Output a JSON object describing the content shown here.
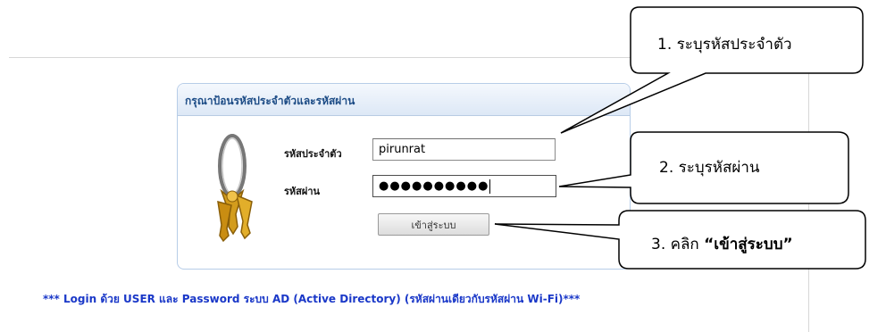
{
  "panel": {
    "title": "กรุณาป้อนรหัสประจำตัวและรหัสผ่าน",
    "user_label": "รหัสประจำตัว",
    "password_label": "รหัสผ่าน",
    "user_value": "pirunrat",
    "password_mask": "●●●●●●●●●●",
    "submit_label": "เข้าสู่ระบบ"
  },
  "footer": {
    "note": "*** Login ด้วย USER และ Password ระบบ AD (Active Directory) (รหัสผ่านเดียวกับรหัสผ่าน Wi-Fi)***"
  },
  "callouts": {
    "step1": "1. ระบุรหัสประจำตัว",
    "step2": "2. ระบุรหัสผ่าน",
    "step3_prefix": "3. คลิก ",
    "step3_action": "“เข้าสู่ระบบ”"
  },
  "colors": {
    "panel_border": "#b7cde8",
    "title_text": "#1d4c86",
    "footer_text": "#1a38c8"
  },
  "icons": {
    "keys": "key-icon"
  }
}
